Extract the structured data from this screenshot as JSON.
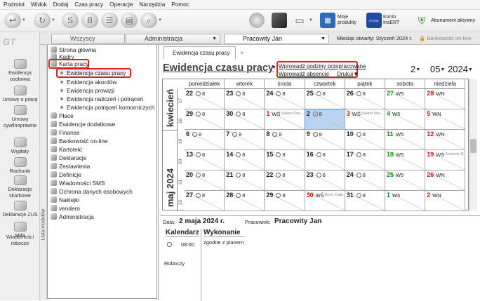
{
  "menu": [
    "Podmiot",
    "Widok",
    "Dodaj",
    "Czas pracy",
    "Operacje",
    "Narzędzia",
    "Pomoc"
  ],
  "toolbar": {
    "moje_produkty": [
      "Moje",
      "produkty"
    ],
    "konto": [
      "Konto",
      "InsERT"
    ],
    "abonament": "Abonament aktywny",
    "store": "STORE"
  },
  "left_nav": [
    {
      "label": "Ewidencja osobowa",
      "icon": "people-icon"
    },
    {
      "label": "Umowy o pracę",
      "icon": "contract-icon"
    },
    {
      "label": "Umowy cywilnoprawne",
      "icon": "contract-civil-icon"
    },
    {
      "label": "Wypłaty",
      "icon": "payment-icon"
    },
    {
      "label": "Rachunki",
      "icon": "bill-icon"
    },
    {
      "label": "Deklaracje skarbowe",
      "icon": "tax-icon"
    },
    {
      "label": "Deklaracje ZUS",
      "icon": "zus-icon"
    },
    {
      "label": "SMS",
      "icon": "sms-icon"
    },
    {
      "label": "Wiadomości robocze",
      "icon": "drafts-icon"
    }
  ],
  "filters": {
    "wszyscy": "Wszyscy",
    "administracja": "Administracja",
    "pracownik": "Pracowity Jan",
    "miesiac_label": "Miesiąc otwarty:",
    "miesiac_value": "Styczeń 2024 r.",
    "bankowosc": "Bankowość on-line"
  },
  "modules_label": "Lista modułów",
  "tree": [
    {
      "label": "Strona główna",
      "level": 0
    },
    {
      "label": "Kadry",
      "level": 0
    },
    {
      "label": "Karta pracy",
      "level": 0,
      "highlight": true
    },
    {
      "label": "Ewidencja czasu pracy",
      "level": 1,
      "highlight": true
    },
    {
      "label": "Ewidencja akordów",
      "level": 1
    },
    {
      "label": "Ewidencja prowizji",
      "level": 1
    },
    {
      "label": "Ewidencja naliczeń i potrąceń",
      "level": 1
    },
    {
      "label": "Ewidencja potrąceń komorniczych",
      "level": 1
    },
    {
      "label": "Płace",
      "level": 0
    },
    {
      "label": "Ewidencje dodatkowe",
      "level": 0
    },
    {
      "label": "Finanse",
      "level": 0
    },
    {
      "label": "Bankowość on-line",
      "level": 0
    },
    {
      "label": "Kartoteki",
      "level": 0
    },
    {
      "label": "Deklaracje",
      "level": 0
    },
    {
      "label": "Zestawienia",
      "level": 0
    },
    {
      "label": "Definicje",
      "level": 0
    },
    {
      "label": "Wiadomości SMS",
      "level": 0
    },
    {
      "label": "Ochrona danych osobowych",
      "level": 0
    },
    {
      "label": "Naklejki",
      "level": 0
    },
    {
      "label": "vendero",
      "level": 0
    },
    {
      "label": "Administracja",
      "level": 0
    }
  ],
  "document_tab": "Ewidencja czasu pracy",
  "page_title": "Ewidencja czasu pracy",
  "links": {
    "nadgodziny": "Wprowadź godziny przepracowane",
    "absencje": "Wprowadź absencje",
    "drukuj": "Drukuj"
  },
  "date_select": {
    "day": "2",
    "month": "05",
    "year": "2024"
  },
  "weekdays": [
    "poniedziałek",
    "wtorek",
    "środa",
    "czwartek",
    "piątek",
    "sobota",
    "niedziela"
  ],
  "months": [
    {
      "label": "kwiecień"
    },
    {
      "label": "maj 2024"
    }
  ],
  "weeks": [
    "17",
    "18",
    "19",
    "20",
    "21",
    "22"
  ],
  "calendar": [
    [
      {
        "d": "22",
        "t": "8"
      },
      {
        "d": "23",
        "t": "8"
      },
      {
        "d": "24",
        "t": "8"
      },
      {
        "d": "25",
        "t": "8"
      },
      {
        "d": "26",
        "t": "8"
      },
      {
        "d": "27",
        "t": "W5",
        "c": "green"
      },
      {
        "d": "28",
        "t": "WN",
        "c": "red"
      }
    ],
    [
      {
        "d": "29",
        "t": "8"
      },
      {
        "d": "30",
        "t": "8"
      },
      {
        "d": "1",
        "t": "WŚ",
        "c": "red",
        "n": "Święto Pań..."
      },
      {
        "d": "2",
        "t": "8",
        "sel": true
      },
      {
        "d": "3",
        "t": "WŚ",
        "c": "red",
        "n": "Święto Nar..."
      },
      {
        "d": "4",
        "t": "W5",
        "c": "green"
      },
      {
        "d": "5",
        "t": "WN",
        "c": "red"
      }
    ],
    [
      {
        "d": "6",
        "t": "8"
      },
      {
        "d": "7",
        "t": "8"
      },
      {
        "d": "8",
        "t": "8"
      },
      {
        "d": "9",
        "t": "8"
      },
      {
        "d": "10",
        "t": "8"
      },
      {
        "d": "11",
        "t": "W5",
        "c": "green"
      },
      {
        "d": "12",
        "t": "WN",
        "c": "red"
      }
    ],
    [
      {
        "d": "13",
        "t": "8"
      },
      {
        "d": "14",
        "t": "8"
      },
      {
        "d": "15",
        "t": "8"
      },
      {
        "d": "16",
        "t": "8"
      },
      {
        "d": "17",
        "t": "8"
      },
      {
        "d": "18",
        "t": "W5",
        "c": "green"
      },
      {
        "d": "19",
        "t": "WŚ",
        "c": "red",
        "n": "Zesłanie Du..."
      }
    ],
    [
      {
        "d": "20",
        "t": "8"
      },
      {
        "d": "21",
        "t": "8"
      },
      {
        "d": "22",
        "t": "8"
      },
      {
        "d": "23",
        "t": "8"
      },
      {
        "d": "24",
        "t": "8"
      },
      {
        "d": "25",
        "t": "W5",
        "c": "green"
      },
      {
        "d": "26",
        "t": "WN",
        "c": "red"
      }
    ],
    [
      {
        "d": "27",
        "t": "8"
      },
      {
        "d": "28",
        "t": "8"
      },
      {
        "d": "29",
        "t": "8"
      },
      {
        "d": "30",
        "t": "WŚ",
        "c": "red",
        "n": "Boże Ciało"
      },
      {
        "d": "31",
        "t": "8"
      },
      {
        "d": "1",
        "t": "W5",
        "c": "green"
      },
      {
        "d": "2",
        "t": "WN",
        "c": "red"
      }
    ]
  ],
  "detail": {
    "data_label": "Data:",
    "data_value": "2 maja 2024 r.",
    "pracownik_label": "Pracownik:",
    "pracownik_value": "Pracowity Jan",
    "kalendarz": "Kalendarz",
    "wykonanie": "Wykonanie",
    "time": "08:00",
    "status": "zgodne z planem",
    "type": "Roboczy"
  },
  "colors": {
    "red": "#d41414",
    "green": "#1a8a1a",
    "selected": "#b8d4f0",
    "highlight": "#e02020"
  }
}
